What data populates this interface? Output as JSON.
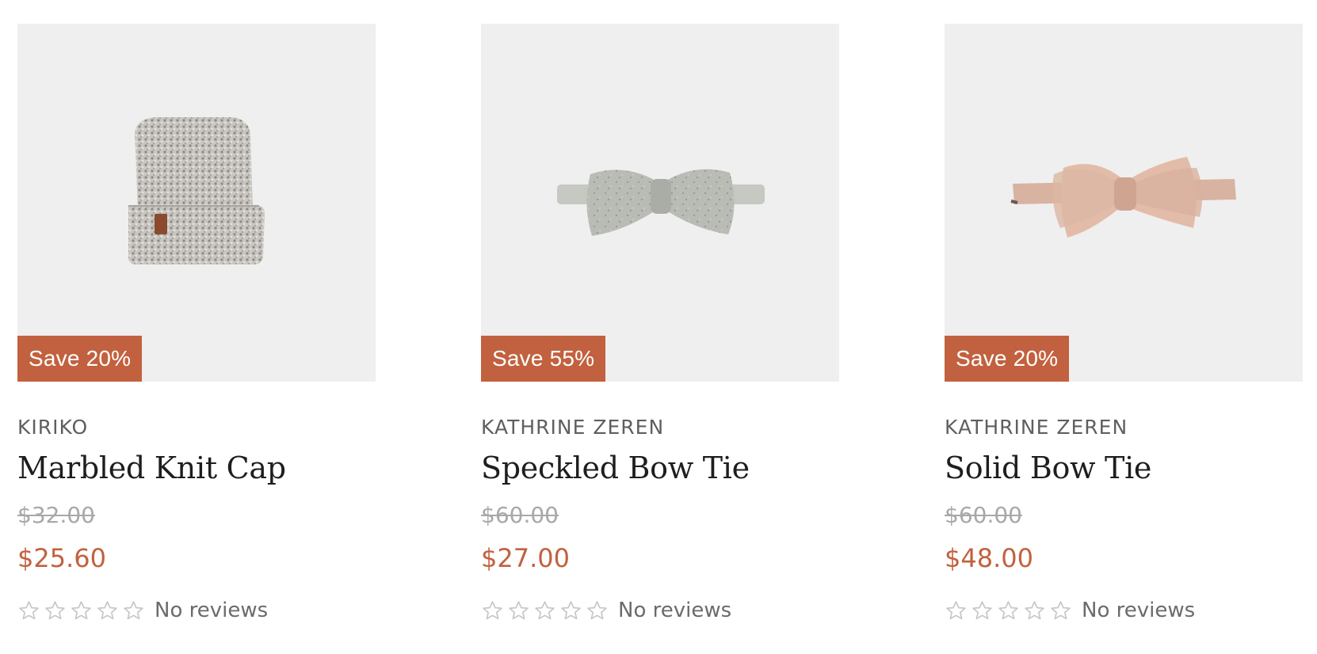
{
  "theme": {
    "accent": "#c2613f",
    "image_bg": "#efefef"
  },
  "products": [
    {
      "badge": "Save 20%",
      "vendor": "KIRIKO",
      "title": "Marbled Knit Cap",
      "compare_price": "$32.00",
      "price": "$25.60",
      "reviews_label": "No reviews",
      "rating": 0,
      "image_icon": "knit-cap-image"
    },
    {
      "badge": "Save 55%",
      "vendor": "KATHRINE ZEREN",
      "title": "Speckled Bow Tie",
      "compare_price": "$60.00",
      "price": "$27.00",
      "reviews_label": "No reviews",
      "rating": 0,
      "image_icon": "speckled-bow-tie-image"
    },
    {
      "badge": "Save 20%",
      "vendor": "KATHRINE ZEREN",
      "title": "Solid Bow Tie",
      "compare_price": "$60.00",
      "price": "$48.00",
      "reviews_label": "No reviews",
      "rating": 0,
      "image_icon": "solid-bow-tie-image"
    }
  ]
}
